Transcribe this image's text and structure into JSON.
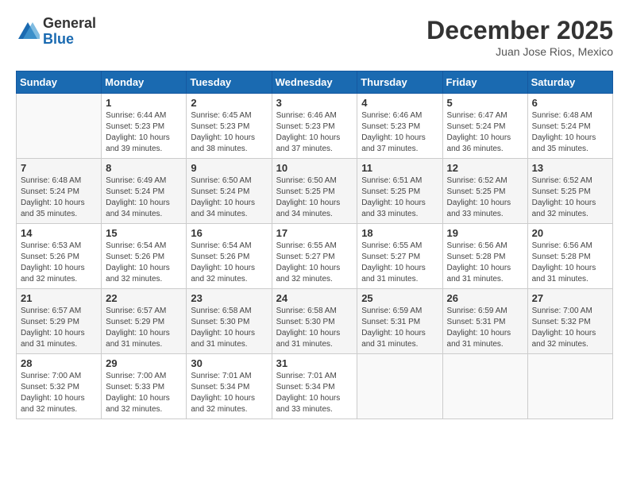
{
  "header": {
    "logo_general": "General",
    "logo_blue": "Blue",
    "month_title": "December 2025",
    "location": "Juan Jose Rios, Mexico"
  },
  "weekdays": [
    "Sunday",
    "Monday",
    "Tuesday",
    "Wednesday",
    "Thursday",
    "Friday",
    "Saturday"
  ],
  "weeks": [
    [
      {
        "day": "",
        "info": ""
      },
      {
        "day": "1",
        "info": "Sunrise: 6:44 AM\nSunset: 5:23 PM\nDaylight: 10 hours\nand 39 minutes."
      },
      {
        "day": "2",
        "info": "Sunrise: 6:45 AM\nSunset: 5:23 PM\nDaylight: 10 hours\nand 38 minutes."
      },
      {
        "day": "3",
        "info": "Sunrise: 6:46 AM\nSunset: 5:23 PM\nDaylight: 10 hours\nand 37 minutes."
      },
      {
        "day": "4",
        "info": "Sunrise: 6:46 AM\nSunset: 5:23 PM\nDaylight: 10 hours\nand 37 minutes."
      },
      {
        "day": "5",
        "info": "Sunrise: 6:47 AM\nSunset: 5:24 PM\nDaylight: 10 hours\nand 36 minutes."
      },
      {
        "day": "6",
        "info": "Sunrise: 6:48 AM\nSunset: 5:24 PM\nDaylight: 10 hours\nand 35 minutes."
      }
    ],
    [
      {
        "day": "7",
        "info": "Sunrise: 6:48 AM\nSunset: 5:24 PM\nDaylight: 10 hours\nand 35 minutes."
      },
      {
        "day": "8",
        "info": "Sunrise: 6:49 AM\nSunset: 5:24 PM\nDaylight: 10 hours\nand 34 minutes."
      },
      {
        "day": "9",
        "info": "Sunrise: 6:50 AM\nSunset: 5:24 PM\nDaylight: 10 hours\nand 34 minutes."
      },
      {
        "day": "10",
        "info": "Sunrise: 6:50 AM\nSunset: 5:25 PM\nDaylight: 10 hours\nand 34 minutes."
      },
      {
        "day": "11",
        "info": "Sunrise: 6:51 AM\nSunset: 5:25 PM\nDaylight: 10 hours\nand 33 minutes."
      },
      {
        "day": "12",
        "info": "Sunrise: 6:52 AM\nSunset: 5:25 PM\nDaylight: 10 hours\nand 33 minutes."
      },
      {
        "day": "13",
        "info": "Sunrise: 6:52 AM\nSunset: 5:25 PM\nDaylight: 10 hours\nand 32 minutes."
      }
    ],
    [
      {
        "day": "14",
        "info": "Sunrise: 6:53 AM\nSunset: 5:26 PM\nDaylight: 10 hours\nand 32 minutes."
      },
      {
        "day": "15",
        "info": "Sunrise: 6:54 AM\nSunset: 5:26 PM\nDaylight: 10 hours\nand 32 minutes."
      },
      {
        "day": "16",
        "info": "Sunrise: 6:54 AM\nSunset: 5:26 PM\nDaylight: 10 hours\nand 32 minutes."
      },
      {
        "day": "17",
        "info": "Sunrise: 6:55 AM\nSunset: 5:27 PM\nDaylight: 10 hours\nand 32 minutes."
      },
      {
        "day": "18",
        "info": "Sunrise: 6:55 AM\nSunset: 5:27 PM\nDaylight: 10 hours\nand 31 minutes."
      },
      {
        "day": "19",
        "info": "Sunrise: 6:56 AM\nSunset: 5:28 PM\nDaylight: 10 hours\nand 31 minutes."
      },
      {
        "day": "20",
        "info": "Sunrise: 6:56 AM\nSunset: 5:28 PM\nDaylight: 10 hours\nand 31 minutes."
      }
    ],
    [
      {
        "day": "21",
        "info": "Sunrise: 6:57 AM\nSunset: 5:29 PM\nDaylight: 10 hours\nand 31 minutes."
      },
      {
        "day": "22",
        "info": "Sunrise: 6:57 AM\nSunset: 5:29 PM\nDaylight: 10 hours\nand 31 minutes."
      },
      {
        "day": "23",
        "info": "Sunrise: 6:58 AM\nSunset: 5:30 PM\nDaylight: 10 hours\nand 31 minutes."
      },
      {
        "day": "24",
        "info": "Sunrise: 6:58 AM\nSunset: 5:30 PM\nDaylight: 10 hours\nand 31 minutes."
      },
      {
        "day": "25",
        "info": "Sunrise: 6:59 AM\nSunset: 5:31 PM\nDaylight: 10 hours\nand 31 minutes."
      },
      {
        "day": "26",
        "info": "Sunrise: 6:59 AM\nSunset: 5:31 PM\nDaylight: 10 hours\nand 31 minutes."
      },
      {
        "day": "27",
        "info": "Sunrise: 7:00 AM\nSunset: 5:32 PM\nDaylight: 10 hours\nand 32 minutes."
      }
    ],
    [
      {
        "day": "28",
        "info": "Sunrise: 7:00 AM\nSunset: 5:32 PM\nDaylight: 10 hours\nand 32 minutes."
      },
      {
        "day": "29",
        "info": "Sunrise: 7:00 AM\nSunset: 5:33 PM\nDaylight: 10 hours\nand 32 minutes."
      },
      {
        "day": "30",
        "info": "Sunrise: 7:01 AM\nSunset: 5:34 PM\nDaylight: 10 hours\nand 32 minutes."
      },
      {
        "day": "31",
        "info": "Sunrise: 7:01 AM\nSunset: 5:34 PM\nDaylight: 10 hours\nand 33 minutes."
      },
      {
        "day": "",
        "info": ""
      },
      {
        "day": "",
        "info": ""
      },
      {
        "day": "",
        "info": ""
      }
    ]
  ]
}
